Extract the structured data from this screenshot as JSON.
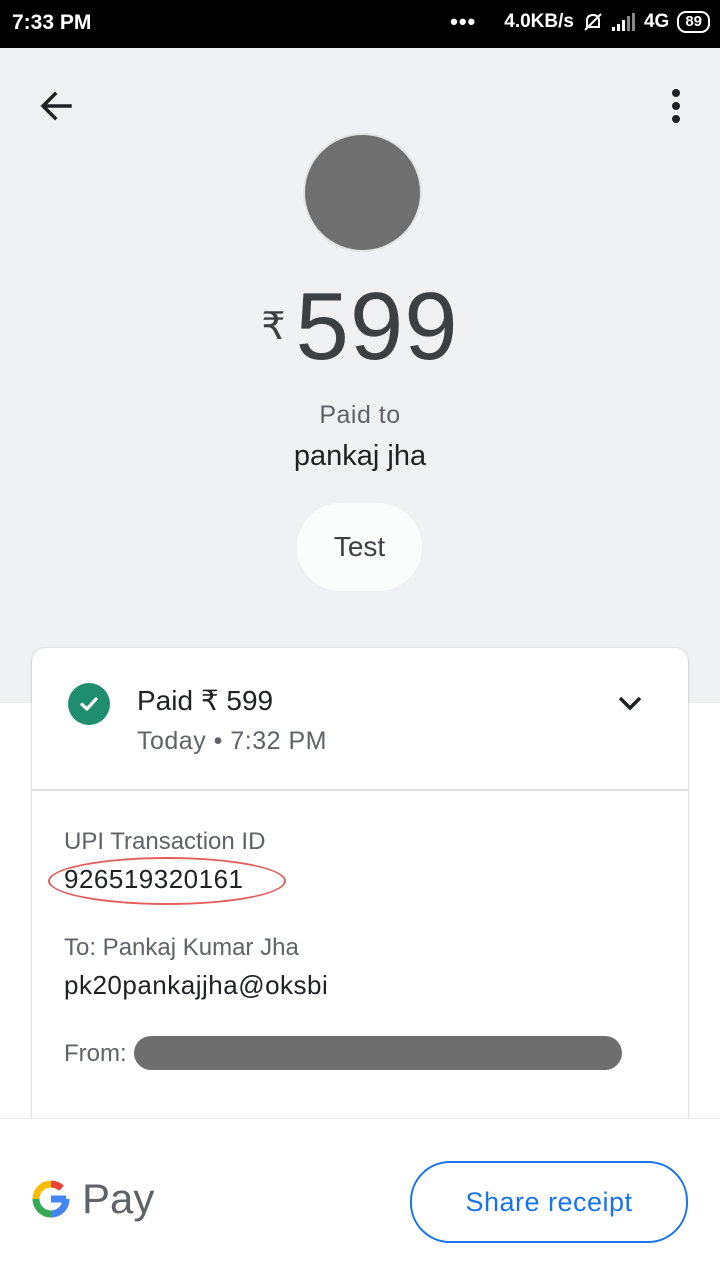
{
  "status_bar": {
    "time": "7:33 PM",
    "dots": "•••",
    "network_speed": "4.0KB/s",
    "network_type": "4G",
    "battery": "89"
  },
  "header": {
    "back_icon": "arrow-left-icon",
    "menu_icon": "more-vert-icon"
  },
  "payment": {
    "currency_symbol": "₹",
    "amount": "599",
    "paid_to_label": "Paid to",
    "payee_name": "pankaj jha",
    "note": "Test"
  },
  "status_card": {
    "title": "Paid ₹ 599",
    "subtitle": "Today • 7:32 PM",
    "check_icon": "check-circle-icon",
    "expand_icon": "chevron-down-icon",
    "status_color": "#1e8e6e"
  },
  "details": {
    "upi_label": "UPI Transaction ID",
    "upi_id": "926519320161",
    "to_label": "To: Pankaj Kumar Jha",
    "to_vpa": "pk20pankajjha@oksbi",
    "from_label": "From:"
  },
  "footer": {
    "brand_pay": "Pay",
    "share_button": "Share receipt",
    "accent_color": "#1a73e8"
  }
}
